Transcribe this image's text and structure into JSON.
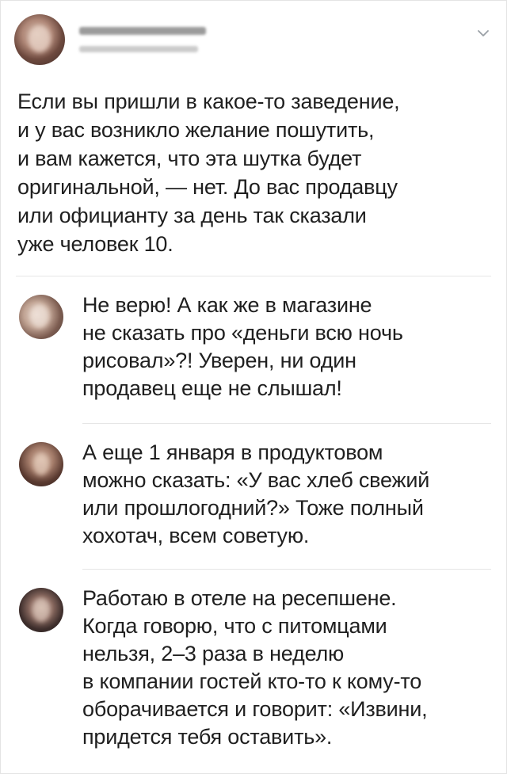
{
  "post": {
    "text_lines": [
      "Если вы пришли в какое-то заведение,",
      "и у вас возникло желание пошутить,",
      "и вам кажется, что эта шутка будет",
      "оригинальной, — нет. До вас продавцу",
      "или официанту за день так сказали",
      "уже человек 10."
    ],
    "menu_icon": "chevron-down-icon"
  },
  "replies": [
    {
      "text_lines": [
        "Не верю! А как же в магазине",
        "не сказать про «деньги всю ночь",
        "рисовал»?! Уверен, ни один",
        "продавец еще не слышал!"
      ]
    },
    {
      "text_lines": [
        "А еще 1 января в продуктовом",
        "можно сказать: «У вас хлеб свежий",
        "или прошлогодний?» Тоже полный",
        "хохотач, всем советую."
      ]
    },
    {
      "text_lines": [
        "Работаю в отеле на ресепшене.",
        "Когда говорю, что с питомцами",
        "нельзя, 2–3 раза в неделю",
        "в компании гостей кто-то к кому-то",
        "оборачивается и говорит: «Извини,",
        "придется тебя оставить»."
      ]
    }
  ],
  "colors": {
    "text": "#1f1f1f",
    "divider": "#e6e6e6",
    "chevron": "#9aa0a6"
  }
}
